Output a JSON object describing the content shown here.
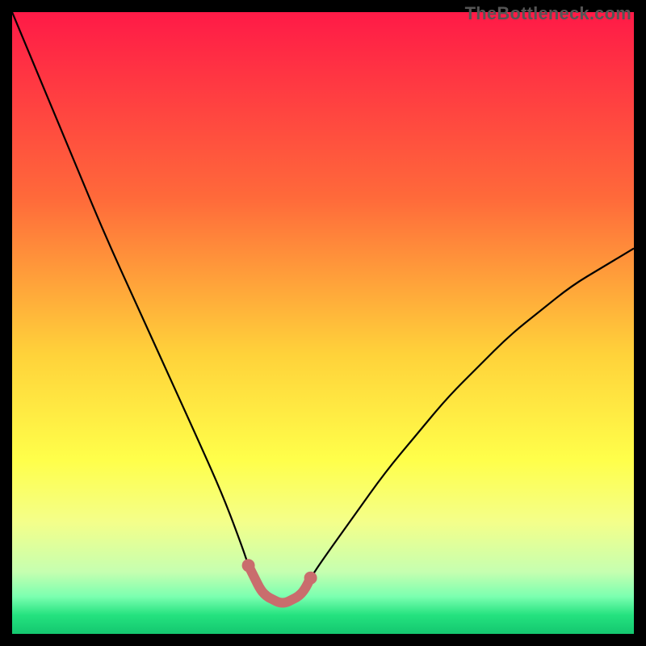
{
  "watermark": "TheBottleneck.com",
  "colors": {
    "bg_black": "#000000",
    "curve_black": "#000000",
    "highlight": "#c96d6d",
    "gradient_stops": [
      {
        "offset": 0.0,
        "color": "#ff1a47"
      },
      {
        "offset": 0.3,
        "color": "#ff6a3a"
      },
      {
        "offset": 0.55,
        "color": "#ffd23a"
      },
      {
        "offset": 0.72,
        "color": "#ffff4a"
      },
      {
        "offset": 0.82,
        "color": "#f4ff8a"
      },
      {
        "offset": 0.9,
        "color": "#c6ffb0"
      },
      {
        "offset": 0.94,
        "color": "#7bffb0"
      },
      {
        "offset": 0.97,
        "color": "#24e27f"
      },
      {
        "offset": 1.0,
        "color": "#14c76f"
      }
    ]
  },
  "chart_data": {
    "type": "line",
    "title": "",
    "xlabel": "",
    "ylabel": "",
    "xlim": [
      0,
      100
    ],
    "ylim": [
      0,
      100
    ],
    "series": [
      {
        "name": "bottleneck-curve",
        "x": [
          0,
          5,
          10,
          15,
          20,
          25,
          30,
          34,
          37,
          38,
          39,
          40,
          41,
          42,
          43,
          44,
          45,
          46,
          47,
          48,
          50,
          55,
          60,
          65,
          70,
          75,
          80,
          85,
          90,
          95,
          100
        ],
        "y": [
          100,
          88,
          76,
          64,
          53,
          42,
          31,
          22,
          14,
          11,
          9,
          7,
          6,
          5.5,
          5,
          5,
          5.5,
          6,
          7,
          9,
          12,
          19,
          26,
          32,
          38,
          43,
          48,
          52,
          56,
          59,
          62
        ]
      },
      {
        "name": "highlight-segment",
        "x": [
          38,
          39,
          40,
          41,
          42,
          43,
          44,
          45,
          46,
          47,
          48
        ],
        "y": [
          11,
          9,
          7,
          6,
          5.5,
          5,
          5,
          5.5,
          6,
          7,
          9
        ]
      }
    ],
    "annotations": []
  }
}
